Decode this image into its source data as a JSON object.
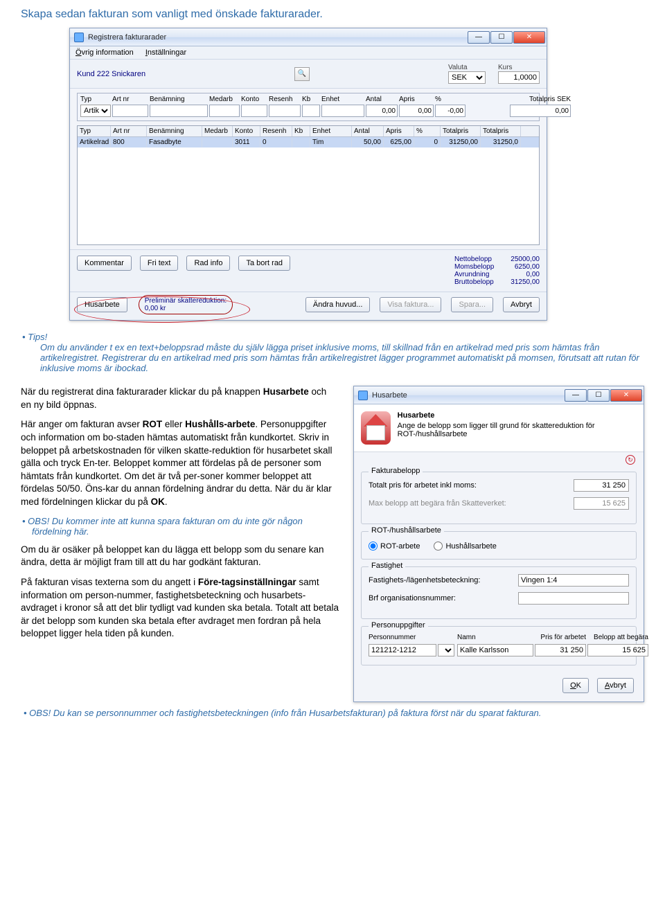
{
  "heading1": "Skapa sedan fakturan som vanligt med önskade fakturarader.",
  "window1": {
    "title": "Registrera fakturarader",
    "menu1": "Övrig information",
    "menu2": "Inställningar",
    "kund": "Kund 222 Snickaren",
    "valuta_label": "Valuta",
    "valuta_val": "SEK",
    "kurs_label": "Kurs",
    "kurs_val": "1,0000",
    "hdr": {
      "typ": "Typ",
      "artnr": "Art nr",
      "benamning": "Benämning",
      "medarb": "Medarb",
      "konto": "Konto",
      "resenh": "Resenh",
      "kb": "Kb",
      "enhet": "Enhet",
      "antal": "Antal",
      "apris": "Apris",
      "pct": "%",
      "total": "Totalpris SEK"
    },
    "entry": {
      "typ": "Artik",
      "antal": "0,00",
      "apris": "0,00",
      "pct": "-0,00",
      "total": "0,00"
    },
    "ghdr": {
      "typ": "Typ",
      "artnr": "Art nr",
      "benamning": "Benämning",
      "medarb": "Medarb",
      "konto": "Konto",
      "resenh": "Resenh",
      "kb": "Kb",
      "enhet": "Enhet",
      "antal": "Antal",
      "apris": "Apris",
      "pct": "%",
      "tp": "Totalpris",
      "tp2": "Totalpris"
    },
    "row": {
      "typ": "Artikelrad",
      "artnr": "800",
      "benamning": "Fasadbyte",
      "medarb": "",
      "konto": "3011",
      "resenh": "0",
      "kb": "",
      "enhet": "Tim",
      "antal": "50,00",
      "apris": "625,00",
      "pct": "0",
      "tp": "31250,00",
      "tp2": "31250,0"
    },
    "btns": {
      "kommentar": "Kommentar",
      "fritext": "Fri text",
      "rad": "Rad info",
      "tabort": "Ta bort rad"
    },
    "totals": {
      "nettol": "Nettobelopp",
      "netto": "25000,00",
      "momsl": "Momsbelopp",
      "moms": "6250,00",
      "avrundl": "Avrundning",
      "avrund": "0,00",
      "bruttol": "Bruttobelopp",
      "brutto": "31250,00"
    },
    "footer": {
      "hus": "Husarbete",
      "prelim": "Preliminär skattereduktion:",
      "prelim2": "0,00 kr",
      "andra": "Ändra huvud...",
      "visa": "Visa faktura...",
      "spara": "Spara...",
      "avbryt": "Avbryt"
    }
  },
  "tips_label": "Tips!",
  "tips_para": "Om du använder t ex en text+beloppsrad måste du själv lägga priset inklusive moms, till skillnad från en artikelrad med pris som hämtas från artikelregistret. Registrerar du en artikelrad med pris som hämtas från artikelregistret lägger programmet automatiskt på momsen, förutsatt att rutan för inklusive moms är ibockad.",
  "body": {
    "p1a": "När du registrerat dina fakturarader klickar du på knappen ",
    "p1b": "Husarbete",
    "p1c": " och en ny bild öppnas.",
    "p2a": "Här anger om fakturan avser ",
    "p2b": "ROT",
    "p2c": " eller ",
    "p2d": "Hushålls-arbete",
    "p2e": ". Personuppgifter och information om bo-staden hämtas automatiskt från kundkortet. Skriv in beloppet på arbetskostnaden för vilken skatte-reduktion för husarbetet skall gälla och tryck En-ter. Beloppet kommer att fördelas på de personer som hämtats från kundkortet. Om det är två per-soner kommer beloppet att fördelas 50/50. Öns-kar du annan fördelning ändrar du detta. När du är klar med fördelningen klickar du på ",
    "p2f": "OK",
    "p2g": ".",
    "obs1": "OBS! Du kommer inte att kunna spara fakturan om du inte gör någon fördelning här.",
    "p3": "Om du är osäker på beloppet kan du lägga ett belopp som du senare kan ändra, detta är möjligt fram till att du har godkänt fakturan.",
    "p4a": "På fakturan visas texterna som du angett i ",
    "p4b": "Före-tagsinställningar",
    "p4c": " samt information om person-nummer, fastighetsbeteckning och husarbets-avdraget i kronor så att det blir tydligt vad kunden ska betala. Totalt att betala är det belopp som kunden ska betala efter avdraget men fordran på hela beloppet ligger hela tiden på kunden.",
    "obs2": "OBS! Du kan se personnummer och fastighetsbeteckningen (info från Husarbetsfakturan) på faktura först när du sparat fakturan."
  },
  "window2": {
    "title": "Husarbete",
    "heading": "Husarbete",
    "subtext": "Ange de belopp som ligger till grund för skattereduktion för ROT-/hushållsarbete",
    "fakturabelopp": "Fakturabelopp",
    "tot_label": "Totalt pris för arbetet inkl moms:",
    "tot_val": "31 250",
    "max_label": "Max belopp att begära från Skatteverket:",
    "max_val": "15 625",
    "rotlegend": "ROT-/hushållsarbete",
    "rot": "ROT-arbete",
    "hus": "Hushållsarbete",
    "fastighet": "Fastighet",
    "fastlabel": "Fastighets-/lägenhetsbeteckning:",
    "fastval": "Vingen 1:4",
    "brflabel": "Brf organisationsnummer:",
    "brfval": "",
    "person": "Personuppgifter",
    "ph": {
      "pn": "Personnummer",
      "namn": "Namn",
      "pris": "Pris för arbetet",
      "belopp": "Belopp att begära"
    },
    "pr": {
      "pn": "121212-1212",
      "namn": "Kalle Karlsson",
      "pris": "31 250",
      "belopp": "15 625"
    },
    "ok": "OK",
    "avbryt": "Avbryt"
  }
}
